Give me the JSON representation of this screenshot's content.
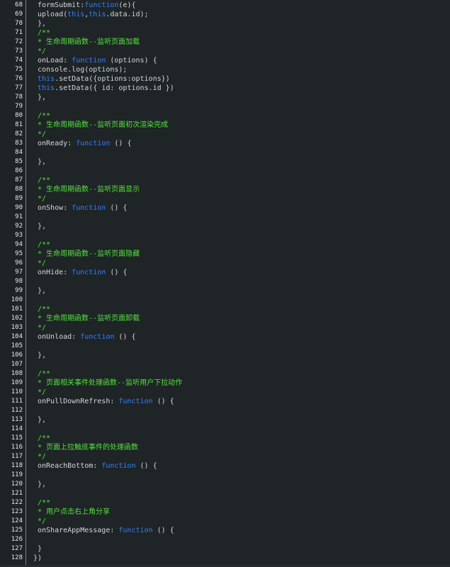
{
  "editor": {
    "colors": {
      "background": "#1f2427",
      "gutter_text": "#e6e8e8",
      "plain": "#d4d7d6",
      "keyword": "#2f82ff",
      "comment": "#52e23c"
    },
    "lines": [
      {
        "n": "68",
        "indent": 1,
        "tokens": [
          {
            "t": "formSubmit:",
            "k": "plain"
          },
          {
            "t": "function",
            "k": "keyword"
          },
          {
            "t": "(e){",
            "k": "plain"
          }
        ]
      },
      {
        "n": "69",
        "indent": 1,
        "tokens": [
          {
            "t": "upload(",
            "k": "plain"
          },
          {
            "t": "this",
            "k": "keyword"
          },
          {
            "t": ",",
            "k": "plain"
          },
          {
            "t": "this",
            "k": "keyword"
          },
          {
            "t": ".data.id);",
            "k": "plain"
          }
        ]
      },
      {
        "n": "70",
        "indent": 1,
        "tokens": [
          {
            "t": "},",
            "k": "plain"
          }
        ]
      },
      {
        "n": "71",
        "indent": 1,
        "tokens": [
          {
            "t": "/**",
            "k": "comment"
          }
        ]
      },
      {
        "n": "72",
        "indent": 1,
        "tokens": [
          {
            "t": "* 生命周期函数--监听页面加载",
            "k": "comment"
          }
        ]
      },
      {
        "n": "73",
        "indent": 1,
        "tokens": [
          {
            "t": "*/",
            "k": "comment"
          }
        ]
      },
      {
        "n": "74",
        "indent": 1,
        "tokens": [
          {
            "t": "onLoad: ",
            "k": "plain"
          },
          {
            "t": "function",
            "k": "keyword"
          },
          {
            "t": " (options) {",
            "k": "plain"
          }
        ]
      },
      {
        "n": "75",
        "indent": 1,
        "tokens": [
          {
            "t": "console.log(options);",
            "k": "plain"
          }
        ]
      },
      {
        "n": "76",
        "indent": 1,
        "tokens": [
          {
            "t": "this",
            "k": "keyword"
          },
          {
            "t": ".setData({options:options})",
            "k": "plain"
          }
        ]
      },
      {
        "n": "77",
        "indent": 1,
        "tokens": [
          {
            "t": "this",
            "k": "keyword"
          },
          {
            "t": ".setData({ id: options.id })",
            "k": "plain"
          }
        ]
      },
      {
        "n": "78",
        "indent": 1,
        "tokens": [
          {
            "t": "},",
            "k": "plain"
          }
        ]
      },
      {
        "n": "79",
        "indent": 1,
        "tokens": []
      },
      {
        "n": "80",
        "indent": 1,
        "tokens": [
          {
            "t": "/**",
            "k": "comment"
          }
        ]
      },
      {
        "n": "81",
        "indent": 1,
        "tokens": [
          {
            "t": "* 生命周期函数--监听页面初次渲染完成",
            "k": "comment"
          }
        ]
      },
      {
        "n": "82",
        "indent": 1,
        "tokens": [
          {
            "t": "*/",
            "k": "comment"
          }
        ]
      },
      {
        "n": "83",
        "indent": 1,
        "tokens": [
          {
            "t": "onReady: ",
            "k": "plain"
          },
          {
            "t": "function",
            "k": "keyword"
          },
          {
            "t": " () {",
            "k": "plain"
          }
        ]
      },
      {
        "n": "84",
        "indent": 1,
        "tokens": []
      },
      {
        "n": "85",
        "indent": 1,
        "tokens": [
          {
            "t": "},",
            "k": "plain"
          }
        ]
      },
      {
        "n": "86",
        "indent": 1,
        "tokens": []
      },
      {
        "n": "87",
        "indent": 1,
        "tokens": [
          {
            "t": "/**",
            "k": "comment"
          }
        ]
      },
      {
        "n": "88",
        "indent": 1,
        "tokens": [
          {
            "t": "* 生命周期函数--监听页面显示",
            "k": "comment"
          }
        ]
      },
      {
        "n": "89",
        "indent": 1,
        "tokens": [
          {
            "t": "*/",
            "k": "comment"
          }
        ]
      },
      {
        "n": "90",
        "indent": 1,
        "tokens": [
          {
            "t": "onShow: ",
            "k": "plain"
          },
          {
            "t": "function",
            "k": "keyword"
          },
          {
            "t": " () {",
            "k": "plain"
          }
        ]
      },
      {
        "n": "91",
        "indent": 1,
        "tokens": []
      },
      {
        "n": "92",
        "indent": 1,
        "tokens": [
          {
            "t": "},",
            "k": "plain"
          }
        ]
      },
      {
        "n": "93",
        "indent": 1,
        "tokens": []
      },
      {
        "n": "94",
        "indent": 1,
        "tokens": [
          {
            "t": "/**",
            "k": "comment"
          }
        ]
      },
      {
        "n": "95",
        "indent": 1,
        "tokens": [
          {
            "t": "* 生命周期函数--监听页面隐藏",
            "k": "comment"
          }
        ]
      },
      {
        "n": "96",
        "indent": 1,
        "tokens": [
          {
            "t": "*/",
            "k": "comment"
          }
        ]
      },
      {
        "n": "97",
        "indent": 1,
        "tokens": [
          {
            "t": "onHide: ",
            "k": "plain"
          },
          {
            "t": "function",
            "k": "keyword"
          },
          {
            "t": " () {",
            "k": "plain"
          }
        ]
      },
      {
        "n": "98",
        "indent": 1,
        "tokens": []
      },
      {
        "n": "99",
        "indent": 1,
        "tokens": [
          {
            "t": "},",
            "k": "plain"
          }
        ]
      },
      {
        "n": "100",
        "indent": 1,
        "tokens": []
      },
      {
        "n": "101",
        "indent": 1,
        "tokens": [
          {
            "t": "/**",
            "k": "comment"
          }
        ]
      },
      {
        "n": "102",
        "indent": 1,
        "tokens": [
          {
            "t": "* 生命周期函数--监听页面卸载",
            "k": "comment"
          }
        ]
      },
      {
        "n": "103",
        "indent": 1,
        "tokens": [
          {
            "t": "*/",
            "k": "comment"
          }
        ]
      },
      {
        "n": "104",
        "indent": 1,
        "tokens": [
          {
            "t": "onUnload: ",
            "k": "plain"
          },
          {
            "t": "function",
            "k": "keyword"
          },
          {
            "t": " () {",
            "k": "plain"
          }
        ]
      },
      {
        "n": "105",
        "indent": 1,
        "tokens": []
      },
      {
        "n": "106",
        "indent": 1,
        "tokens": [
          {
            "t": "},",
            "k": "plain"
          }
        ]
      },
      {
        "n": "107",
        "indent": 1,
        "tokens": []
      },
      {
        "n": "108",
        "indent": 1,
        "tokens": [
          {
            "t": "/**",
            "k": "comment"
          }
        ]
      },
      {
        "n": "109",
        "indent": 1,
        "tokens": [
          {
            "t": "* 页面相关事件处理函数--监听用户下拉动作",
            "k": "comment"
          }
        ]
      },
      {
        "n": "110",
        "indent": 1,
        "tokens": [
          {
            "t": "*/",
            "k": "comment"
          }
        ]
      },
      {
        "n": "111",
        "indent": 1,
        "tokens": [
          {
            "t": "onPullDownRefresh: ",
            "k": "plain"
          },
          {
            "t": "function",
            "k": "keyword"
          },
          {
            "t": " () {",
            "k": "plain"
          }
        ]
      },
      {
        "n": "112",
        "indent": 1,
        "tokens": []
      },
      {
        "n": "113",
        "indent": 1,
        "tokens": [
          {
            "t": "},",
            "k": "plain"
          }
        ]
      },
      {
        "n": "114",
        "indent": 1,
        "tokens": []
      },
      {
        "n": "115",
        "indent": 1,
        "tokens": [
          {
            "t": "/**",
            "k": "comment"
          }
        ]
      },
      {
        "n": "116",
        "indent": 1,
        "tokens": [
          {
            "t": "* 页面上拉触底事件的处理函数",
            "k": "comment"
          }
        ]
      },
      {
        "n": "117",
        "indent": 1,
        "tokens": [
          {
            "t": "*/",
            "k": "comment"
          }
        ]
      },
      {
        "n": "118",
        "indent": 1,
        "tokens": [
          {
            "t": "onReachBottom: ",
            "k": "plain"
          },
          {
            "t": "function",
            "k": "keyword"
          },
          {
            "t": " () {",
            "k": "plain"
          }
        ]
      },
      {
        "n": "119",
        "indent": 1,
        "tokens": []
      },
      {
        "n": "120",
        "indent": 1,
        "tokens": [
          {
            "t": "},",
            "k": "plain"
          }
        ]
      },
      {
        "n": "121",
        "indent": 1,
        "tokens": []
      },
      {
        "n": "122",
        "indent": 1,
        "tokens": [
          {
            "t": "/**",
            "k": "comment"
          }
        ]
      },
      {
        "n": "123",
        "indent": 1,
        "tokens": [
          {
            "t": "* 用户点击右上角分享",
            "k": "comment"
          }
        ]
      },
      {
        "n": "124",
        "indent": 1,
        "tokens": [
          {
            "t": "*/",
            "k": "comment"
          }
        ]
      },
      {
        "n": "125",
        "indent": 1,
        "tokens": [
          {
            "t": "onShareAppMessage: ",
            "k": "plain"
          },
          {
            "t": "function",
            "k": "keyword"
          },
          {
            "t": " () {",
            "k": "plain"
          }
        ]
      },
      {
        "n": "126",
        "indent": 1,
        "tokens": []
      },
      {
        "n": "127",
        "indent": 1,
        "tokens": [
          {
            "t": "}",
            "k": "plain"
          }
        ]
      },
      {
        "n": "128",
        "indent": 0,
        "tokens": [
          {
            "t": "})",
            "k": "plain"
          }
        ]
      }
    ]
  }
}
